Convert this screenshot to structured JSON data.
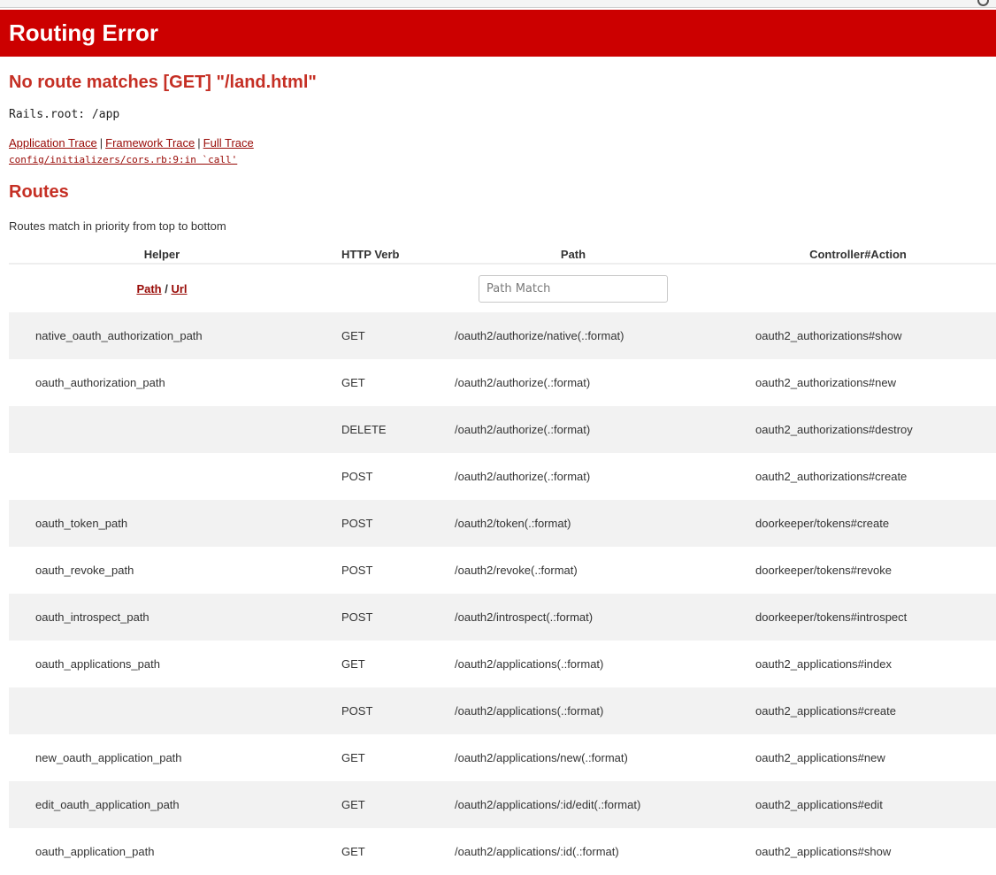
{
  "header": {
    "title": "Routing Error"
  },
  "error": {
    "message": "No route matches [GET] \"/land.html\"",
    "rails_root": "Rails.root: /app"
  },
  "traces": {
    "application": "Application Trace",
    "separator": "|",
    "framework": "Framework Trace",
    "full": "Full Trace",
    "line": "config/initializers/cors.rb:9:in `call'"
  },
  "routes": {
    "title": "Routes",
    "note": "Routes match in priority from top to bottom",
    "columns": {
      "helper": "Helper",
      "verb": "HTTP Verb",
      "path": "Path",
      "action": "Controller#Action"
    },
    "filter": {
      "path_link": "Path",
      "slash": "/",
      "url_link": "Url",
      "placeholder": "Path Match"
    },
    "rows": [
      {
        "helper": "native_oauth_authorization_path",
        "verb": "GET",
        "path": "/oauth2/authorize/native(.:format)",
        "action": "oauth2_authorizations#show"
      },
      {
        "helper": "oauth_authorization_path",
        "verb": "GET",
        "path": "/oauth2/authorize(.:format)",
        "action": "oauth2_authorizations#new"
      },
      {
        "helper": "",
        "verb": "DELETE",
        "path": "/oauth2/authorize(.:format)",
        "action": "oauth2_authorizations#destroy"
      },
      {
        "helper": "",
        "verb": "POST",
        "path": "/oauth2/authorize(.:format)",
        "action": "oauth2_authorizations#create"
      },
      {
        "helper": "oauth_token_path",
        "verb": "POST",
        "path": "/oauth2/token(.:format)",
        "action": "doorkeeper/tokens#create"
      },
      {
        "helper": "oauth_revoke_path",
        "verb": "POST",
        "path": "/oauth2/revoke(.:format)",
        "action": "doorkeeper/tokens#revoke"
      },
      {
        "helper": "oauth_introspect_path",
        "verb": "POST",
        "path": "/oauth2/introspect(.:format)",
        "action": "doorkeeper/tokens#introspect"
      },
      {
        "helper": "oauth_applications_path",
        "verb": "GET",
        "path": "/oauth2/applications(.:format)",
        "action": "oauth2_applications#index"
      },
      {
        "helper": "",
        "verb": "POST",
        "path": "/oauth2/applications(.:format)",
        "action": "oauth2_applications#create"
      },
      {
        "helper": "new_oauth_application_path",
        "verb": "GET",
        "path": "/oauth2/applications/new(.:format)",
        "action": "oauth2_applications#new"
      },
      {
        "helper": "edit_oauth_application_path",
        "verb": "GET",
        "path": "/oauth2/applications/:id/edit(.:format)",
        "action": "oauth2_applications#edit"
      },
      {
        "helper": "oauth_application_path",
        "verb": "GET",
        "path": "/oauth2/applications/:id(.:format)",
        "action": "oauth2_applications#show"
      }
    ]
  },
  "colors": {
    "header_bg": "#cc0000",
    "heading_red": "#c52f24",
    "link": "#980905",
    "stripe": "#f2f2f2"
  }
}
